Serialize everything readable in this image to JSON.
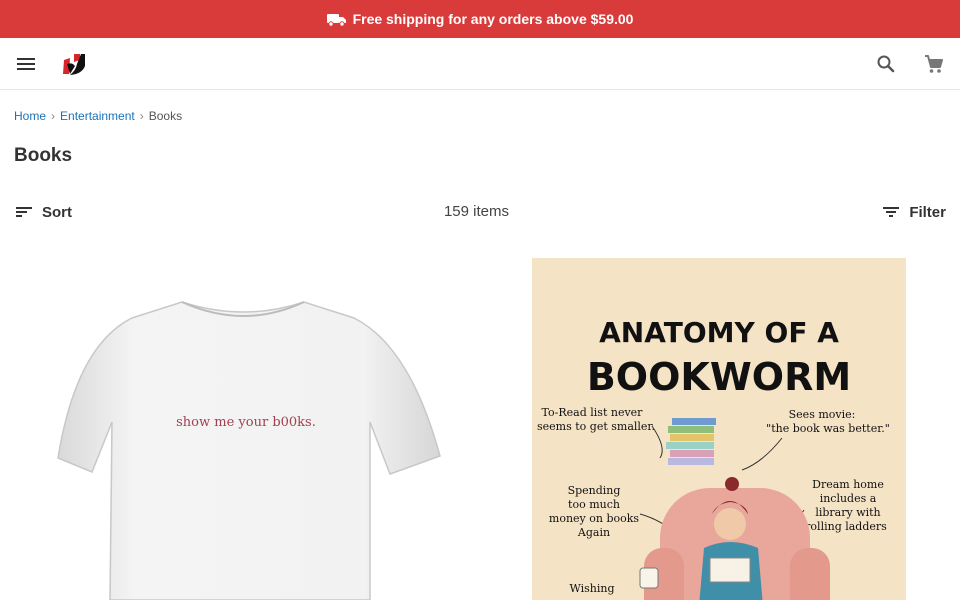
{
  "promo": {
    "text": "Free shipping for any orders above $59.00",
    "icon": "truck-icon"
  },
  "header": {
    "menu_icon": "menu-icon",
    "logo": "brand-logo",
    "search_icon": "search-icon",
    "cart_icon": "cart-icon"
  },
  "breadcrumb": {
    "items": [
      "Home",
      "Entertainment"
    ],
    "current": "Books"
  },
  "page": {
    "title": "Books"
  },
  "toolbar": {
    "sort_label": "Sort",
    "count": "159 items",
    "filter_label": "Filter"
  },
  "products": [
    {
      "image": "t-shirt",
      "print_text": "show me your b00ks."
    },
    {
      "image": "poster",
      "title_line1": "ANATOMY OF A",
      "title_line2": "BOOKWORM",
      "note_tbr_1": "To-Read list never",
      "note_tbr_2": "seems to get smaller.",
      "note_movie_1": "Sees movie:",
      "note_movie_2": "\"the book was better.\"",
      "note_spend_1": "Spending",
      "note_spend_2": "too much",
      "note_spend_3": "money on books",
      "note_spend_4": "Again",
      "note_dream_1": "Dream home",
      "note_dream_2": "includes a",
      "note_dream_3": "library with",
      "note_dream_4": "rolling ladders",
      "note_wish": "Wishing"
    }
  ],
  "colors": {
    "promo_bg": "#d93a3a",
    "link": "#1a73b8",
    "brand": "#d6262a"
  }
}
